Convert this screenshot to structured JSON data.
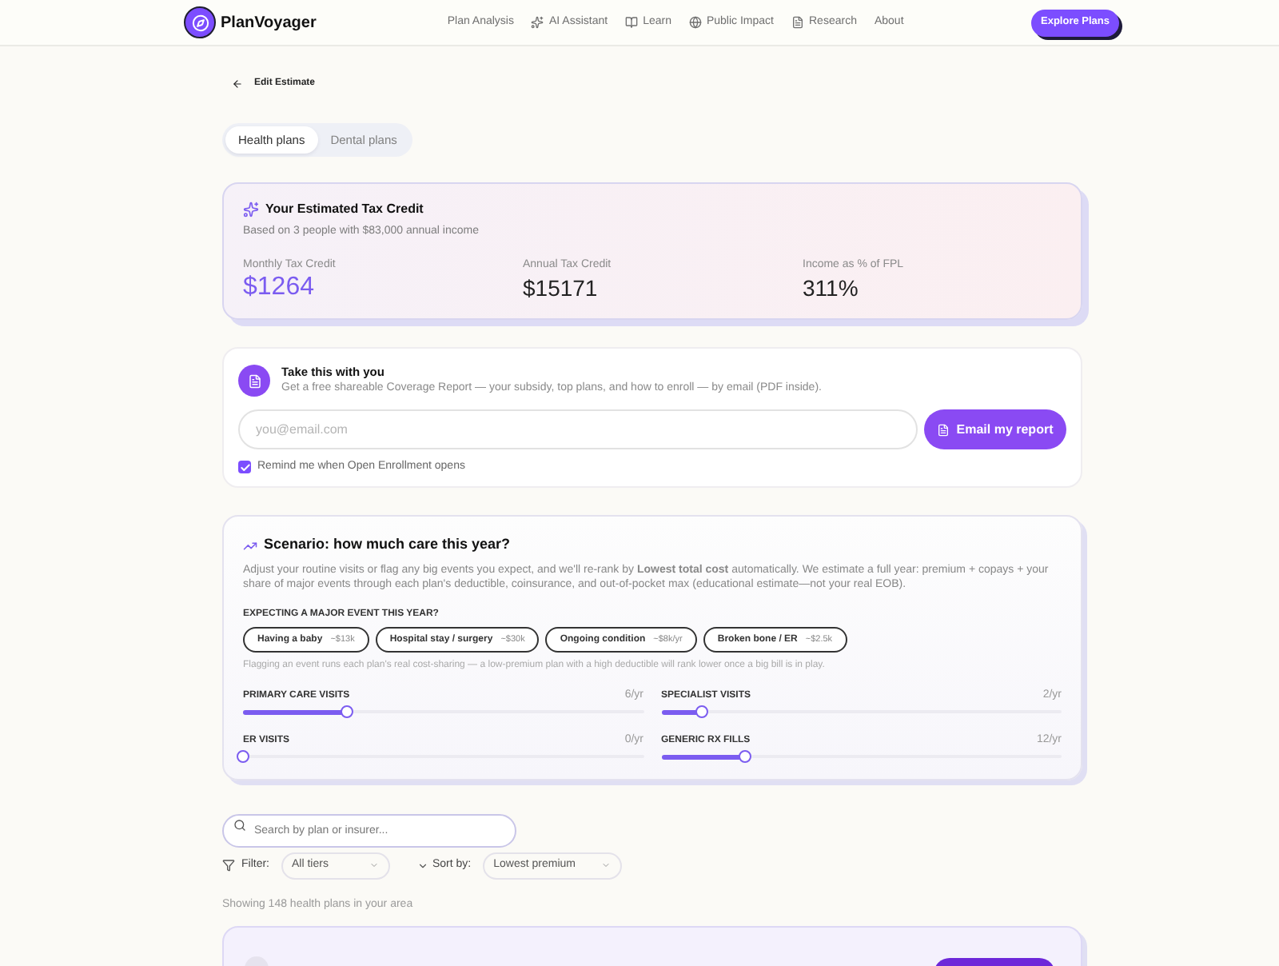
{
  "header": {
    "brand": "PlanVoyager",
    "nav": [
      {
        "label": "Plan Analysis"
      },
      {
        "label": "AI Assistant"
      },
      {
        "label": "Learn"
      },
      {
        "label": "Public Impact"
      },
      {
        "label": "Research"
      },
      {
        "label": "About"
      }
    ],
    "cta": "Explore Plans"
  },
  "back_link": "Edit Estimate",
  "plan_tabs": [
    {
      "label": "Health plans",
      "selected": true
    },
    {
      "label": "Dental plans",
      "selected": false
    }
  ],
  "tax_credit": {
    "title": "Your Estimated Tax Credit",
    "subtitle": "Based on 3 people with $83,000 annual income",
    "stats": [
      {
        "label": "Monthly Tax Credit",
        "value": "$1264",
        "highlight": true
      },
      {
        "label": "Annual Tax Credit",
        "value": "$15171",
        "highlight": false
      },
      {
        "label": "Income as % of FPL",
        "value": "311%",
        "highlight": false
      }
    ]
  },
  "report": {
    "title": "Take this with you",
    "description": "Get a free shareable Coverage Report — your subsidy, top plans, and how to enroll — by email (PDF inside).",
    "email": {
      "placeholder": "you@email.com"
    },
    "button": "Email my report",
    "reminder": {
      "label": "Remind me when Open Enrollment opens",
      "checked": true
    }
  },
  "scenario": {
    "title": "Scenario: how much care this year?",
    "description": "Adjust your routine visits or flag any big events you expect, and we'll re-rank by **Lowest total cost** automatically. We estimate a full year: premium + copays + your share of major events through each plan's deductible, coinsurance, and out-of-pocket max (educational estimate—not your real EOB).",
    "events_label": "EXPECTING A MAJOR EVENT THIS YEAR?",
    "events": [
      {
        "label": "Having a baby",
        "cost": "~$13k",
        "selected": false
      },
      {
        "label": "Hospital stay / surgery",
        "cost": "~$30k",
        "selected": false
      },
      {
        "label": "Ongoing condition",
        "cost": "~$8k/yr",
        "selected": false
      },
      {
        "label": "Broken bone / ER",
        "cost": "~$2.5k",
        "selected": false
      }
    ],
    "events_note": "Flagging an event runs each plan's real cost-sharing — a low-premium plan with a high deductible will rank lower once a big bill is in play.",
    "sliders": [
      {
        "label": "PRIMARY CARE VISITS",
        "reading": "6/yr",
        "level": 0.26
      },
      {
        "label": "SPECIALIST VISITS",
        "reading": "2/yr",
        "level": 0.1
      },
      {
        "label": "ER VISITS",
        "reading": "0/yr",
        "level": 0
      },
      {
        "label": "GENERIC RX FILLS",
        "reading": "12/yr",
        "level": 0.21
      }
    ]
  },
  "search": {
    "placeholder": "Search by plan or insurer..."
  },
  "filter": {
    "label": "Filter:",
    "value": "All tiers"
  },
  "sort": {
    "label": "Sort by:",
    "value": "Lowest premium"
  },
  "results_count": "Showing 148 health plans in your area"
}
